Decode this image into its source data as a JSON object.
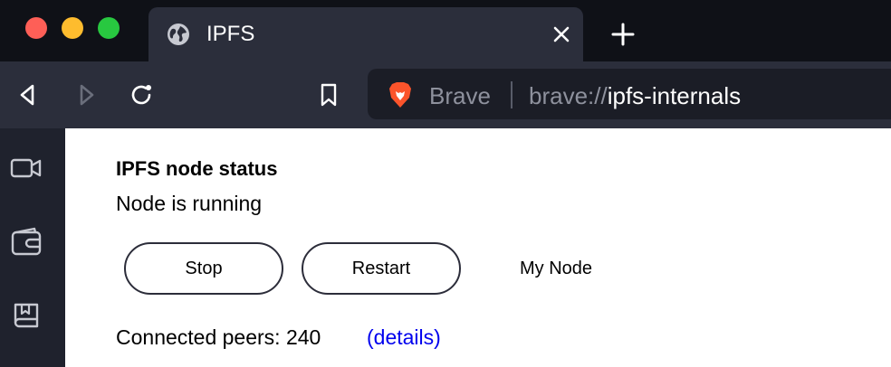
{
  "window": {
    "traffic_lights": [
      "close",
      "minimize",
      "zoom"
    ],
    "colors": {
      "close": "#fe5f57",
      "minimize": "#febc2e",
      "zoom": "#28c840"
    }
  },
  "tab": {
    "title": "IPFS",
    "icon": "globe-icon",
    "close_icon": "close-icon"
  },
  "new_tab_icon": "plus-icon",
  "toolbar": {
    "back_icon": "back-arrow-icon",
    "forward_icon": "forward-arrow-icon",
    "reload_icon": "reload-icon",
    "bookmark_icon": "bookmark-icon"
  },
  "urlbar": {
    "brand_label": "Brave",
    "url_scheme": "brave://",
    "url_host": "ipfs-internals",
    "brand_icon": "brave-lion-icon",
    "brand_color": "#fb542b"
  },
  "sidebar": {
    "items": [
      {
        "icon": "video-camera-icon"
      },
      {
        "icon": "wallet-icon"
      },
      {
        "icon": "reading-list-icon"
      }
    ]
  },
  "page": {
    "heading": "IPFS node status",
    "status": "Node is running",
    "stop_label": "Stop",
    "restart_label": "Restart",
    "my_node_label": "My Node",
    "peers_label": "Connected peers: 240",
    "details_label": "(details)",
    "link_color": "#0000ee"
  }
}
